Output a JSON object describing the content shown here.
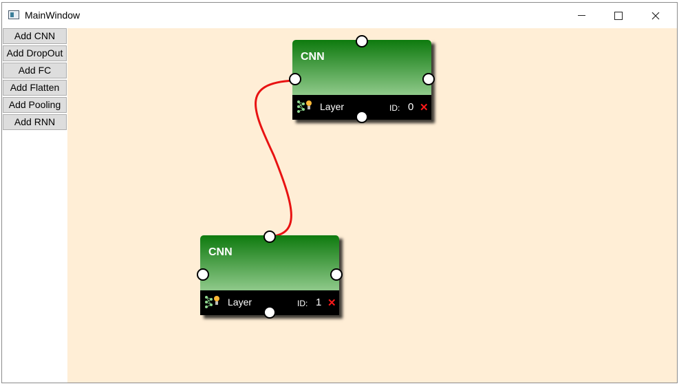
{
  "window": {
    "title": "MainWindow"
  },
  "sidebar": {
    "buttons": [
      {
        "label": "Add CNN"
      },
      {
        "label": "Add DropOut"
      },
      {
        "label": "Add FC"
      },
      {
        "label": "Add Flatten"
      },
      {
        "label": "Add Pooling"
      },
      {
        "label": "Add RNN"
      }
    ]
  },
  "nodes": [
    {
      "title": "CNN",
      "layer_label": "Layer",
      "id_label": "ID:",
      "id_value": "0",
      "delete_glyph": "✕"
    },
    {
      "title": "CNN",
      "layer_label": "Layer",
      "id_label": "ID:",
      "id_value": "1",
      "delete_glyph": "✕"
    }
  ],
  "colors": {
    "canvas": "#ffeed6",
    "node_header_top": "#0e7a0e",
    "node_header_bottom": "#8fc98a",
    "wire": "#e81212",
    "delete": "#ff1a1a"
  },
  "icons": {
    "app": "window-app-icon",
    "minimize": "minimize-icon",
    "maximize": "maximize-icon",
    "close": "close-icon",
    "layer": "neural-network-lightbulb-icon",
    "delete": "delete-x-icon"
  }
}
